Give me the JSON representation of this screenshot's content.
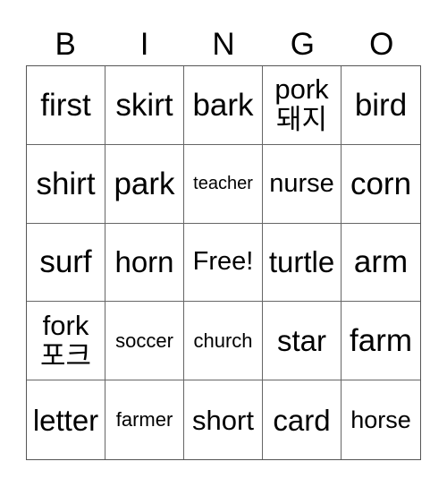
{
  "header": [
    "B",
    "I",
    "N",
    "G",
    "O"
  ],
  "cells": [
    {
      "line1": "first",
      "line2": ""
    },
    {
      "line1": "skirt",
      "line2": ""
    },
    {
      "line1": "bark",
      "line2": ""
    },
    {
      "line1": "pork",
      "line2": "돼지"
    },
    {
      "line1": "bird",
      "line2": ""
    },
    {
      "line1": "shirt",
      "line2": ""
    },
    {
      "line1": "park",
      "line2": ""
    },
    {
      "line1": "teacher",
      "line2": ""
    },
    {
      "line1": "nurse",
      "line2": ""
    },
    {
      "line1": "corn",
      "line2": ""
    },
    {
      "line1": "surf",
      "line2": ""
    },
    {
      "line1": "horn",
      "line2": ""
    },
    {
      "line1": "Free!",
      "line2": ""
    },
    {
      "line1": "turtle",
      "line2": ""
    },
    {
      "line1": "arm",
      "line2": ""
    },
    {
      "line1": "fork",
      "line2": "포크"
    },
    {
      "line1": "soccer",
      "line2": ""
    },
    {
      "line1": "church",
      "line2": ""
    },
    {
      "line1": "star",
      "line2": ""
    },
    {
      "line1": "farm",
      "line2": ""
    },
    {
      "line1": "letter",
      "line2": ""
    },
    {
      "line1": "farmer",
      "line2": ""
    },
    {
      "line1": "short",
      "line2": ""
    },
    {
      "line1": "card",
      "line2": ""
    },
    {
      "line1": "horse",
      "line2": ""
    }
  ]
}
